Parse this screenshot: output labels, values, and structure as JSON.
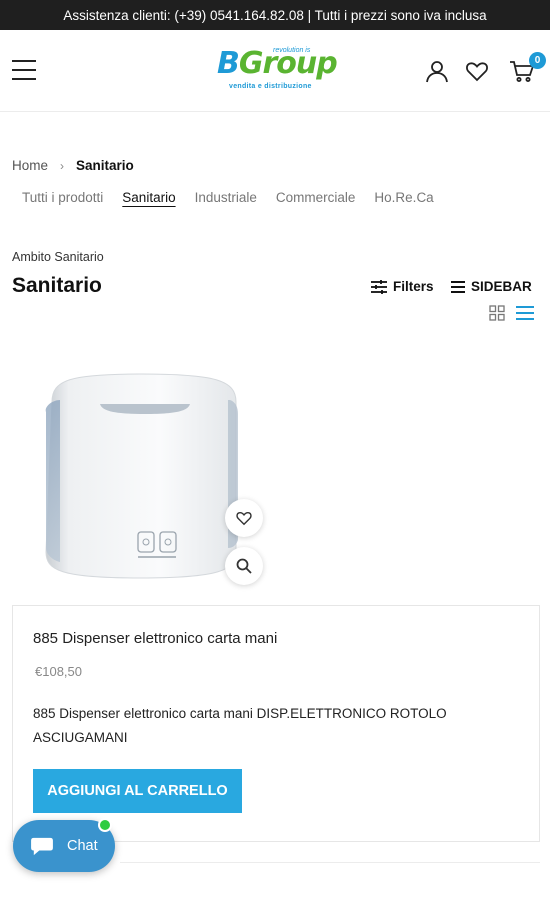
{
  "topbar": {
    "text": "Assistenza clienti: (+39)  0541.164.82.08 | Tutti i prezzi sono iva inclusa"
  },
  "header": {
    "logo": {
      "main_b": "B",
      "main_rest": "Group",
      "tagline": "revolution is",
      "subtitle": "vendita e distribuzione"
    },
    "cart_count": "0",
    "icons": [
      "menu-icon",
      "user-icon",
      "heart-icon",
      "cart-icon"
    ]
  },
  "breadcrumb": {
    "home": "Home",
    "separator": "›",
    "current": "Sanitario"
  },
  "categories": [
    {
      "label": "Tutti i prodotti",
      "active": false
    },
    {
      "label": "Sanitario",
      "active": true
    },
    {
      "label": "Industriale",
      "active": false
    },
    {
      "label": "Commerciale",
      "active": false
    },
    {
      "label": "Ho.Re.Ca",
      "active": false
    }
  ],
  "section": {
    "subtitle": "Ambito Sanitario",
    "title": "Sanitario"
  },
  "toolbar": {
    "filters_label": "Filters",
    "sidebar_label": "SIDEBAR",
    "active_view": "list"
  },
  "product": {
    "title": "885 Dispenser elettronico carta mani",
    "price": "€108,50",
    "description": "885 Dispenser elettronico carta mani DISP.ELETTRONICO ROTOLO ASCIUGAMANI",
    "add_to_cart_label": "AGGIUNGI AL CARRELLO"
  },
  "chat": {
    "label": "Chat",
    "online": true
  },
  "colors": {
    "accent": "#29a8e0",
    "logo_blue": "#1e9ad6",
    "logo_green": "#5ab431",
    "topbar_bg": "#1f1f1f",
    "chat_bg": "#3a93cd",
    "online_dot": "#2ecc40"
  }
}
